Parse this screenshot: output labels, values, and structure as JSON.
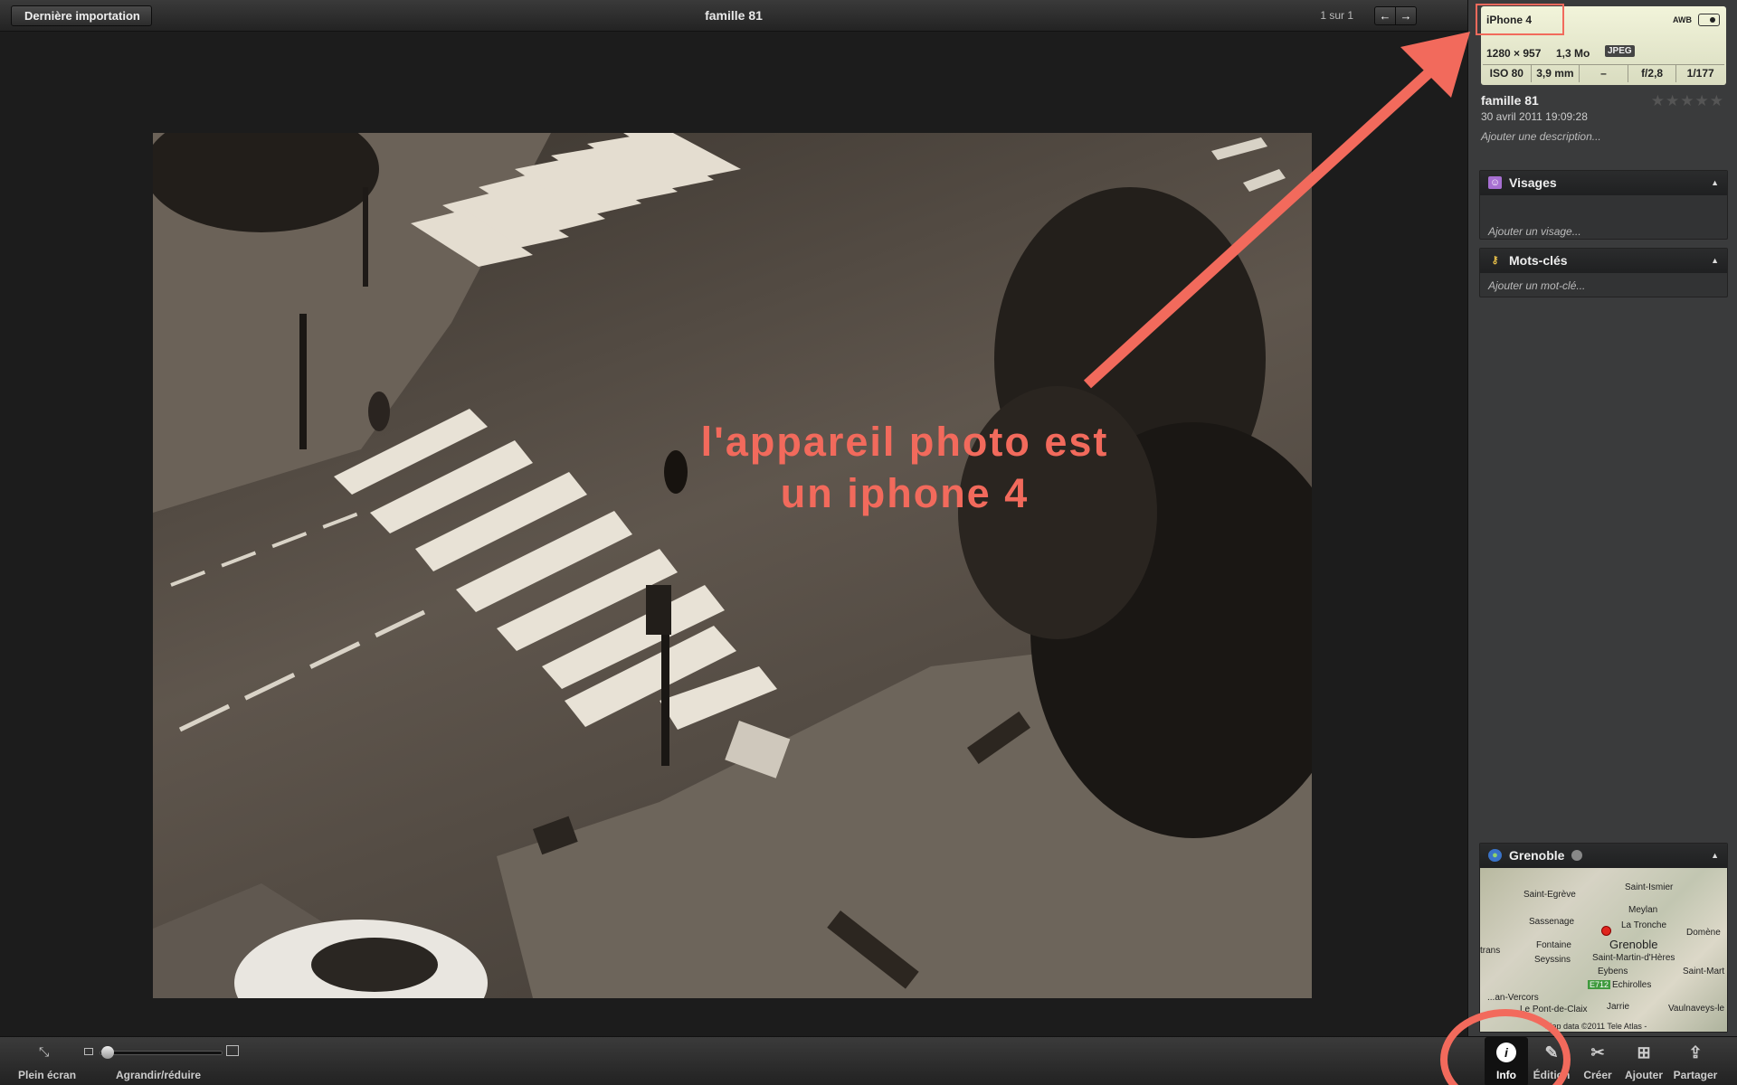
{
  "topbar": {
    "back_label": "Dernière importation",
    "title": "famille 81",
    "counter": "1 sur 1",
    "prev_icon": "←",
    "next_icon": "→"
  },
  "photo": {
    "annotation_line1": "l'appareil photo est",
    "annotation_line2": "un iphone 4"
  },
  "info": {
    "camera": "iPhone 4",
    "white_balance": "AWB",
    "dimensions": "1280 × 957",
    "file_size": "1,3 Mo",
    "format": "JPEG",
    "iso": "ISO 80",
    "focal": "3,9 mm",
    "exposure_comp": "–",
    "aperture": "f/2,8",
    "shutter": "1/177",
    "title": "famille 81",
    "date": "30 avril 2011 19:09:28",
    "rating": "★★★★★",
    "add_description": "Ajouter une description..."
  },
  "faces": {
    "header": "Visages",
    "hint": "Ajouter un visage..."
  },
  "keywords": {
    "header": "Mots-clés",
    "hint": "Ajouter un mot-clé..."
  },
  "place": {
    "header": "Grenoble",
    "map_labels": {
      "saint_egreve": "Saint-Egrève",
      "saint_ismier": "Saint-Ismier",
      "meylan": "Meylan",
      "sassenage": "Sassenage",
      "la_tronche": "La Tronche",
      "domene": "Domène",
      "fontaine": "Fontaine",
      "grenoble": "Grenoble",
      "seyssins": "Seyssins",
      "saint_martin": "Saint-Martin-d'Hères",
      "eybens": "Eybens",
      "saint_mart": "Saint-Mart",
      "trans": "trans",
      "vercors": "...an-Vercors",
      "echirolles": "Echirolles",
      "road": "E712",
      "pont_de_claix": "Le Pont-de-Claix",
      "jarrie": "Jarrie",
      "vaulnaveys": "Vaulnaveys-le"
    },
    "copyright": "Map data ©2011 Tele Atlas -"
  },
  "bottombar": {
    "fullscreen_label": "Plein écran",
    "zoom_label": "Agrandir/réduire",
    "zoom_level": 0.02,
    "tools": {
      "info": "Info",
      "edit": "Édition",
      "create": "Créer",
      "add": "Ajouter",
      "share": "Partager"
    }
  },
  "colors": {
    "annotation_red": "#f26a5c",
    "exif_bg": "#eef0d6"
  }
}
